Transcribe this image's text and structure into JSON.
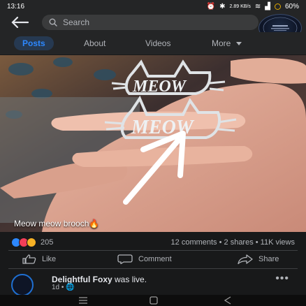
{
  "status": {
    "time": "13:16",
    "speed": "2.89 KB/s",
    "battery": "60%"
  },
  "search": {
    "placeholder": "Search"
  },
  "tabs": {
    "posts": "Posts",
    "about": "About",
    "videos": "Videos",
    "more": "More"
  },
  "photo": {
    "brooch_text": "MEOW",
    "caption": "Meow meow brooch🔥"
  },
  "metrics": {
    "reactions": "205",
    "stats": "12 comments • 2 shares • 11K views"
  },
  "actions": {
    "like": "Like",
    "comment": "Comment",
    "share": "Share"
  },
  "post": {
    "author": "Delightful Foxy",
    "action": "was live.",
    "age": "1d •"
  },
  "colors": {
    "accent": "#2d88ff",
    "background": "#18191a",
    "bar": "#242526"
  }
}
